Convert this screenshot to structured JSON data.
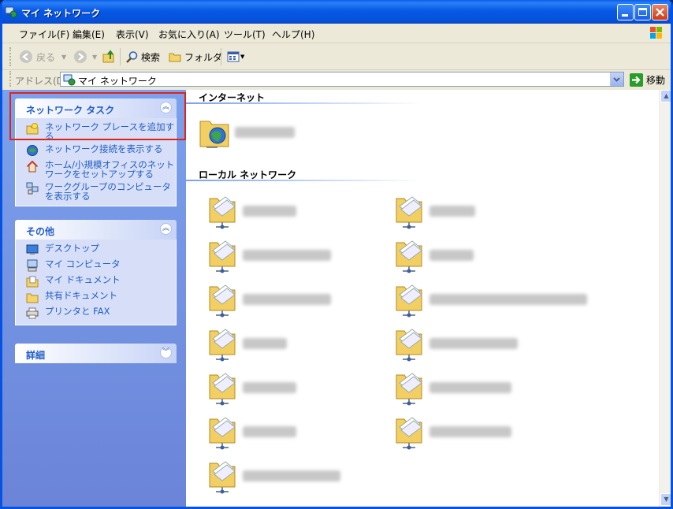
{
  "window": {
    "title": "マイ ネットワーク"
  },
  "menu": [
    "ファイル(F)",
    "編集(E)",
    "表示(V)",
    "お気に入り(A)",
    "ツール(T)",
    "ヘルプ(H)"
  ],
  "toolbar": {
    "back": "戻る",
    "search": "検索",
    "folders": "フォルダ"
  },
  "address": {
    "label": "アドレス(D)",
    "value": "マイ ネットワーク",
    "go": "移動"
  },
  "network_tasks": {
    "title": "ネットワーク タスク",
    "items": [
      "ネットワーク プレースを追加する",
      "ネットワーク接続を表示する",
      "ホーム/小規模オフィスのネットワークをセットアップする",
      "ワークグループのコンピュータを表示する"
    ]
  },
  "other_places": {
    "title": "その他",
    "items": [
      "デスクトップ",
      "マイ コンピュータ",
      "マイ ドキュメント",
      "共有ドキュメント",
      "プリンタと FAX"
    ]
  },
  "details": {
    "title": "詳細"
  },
  "groups": {
    "internet": "インターネット",
    "local": "ローカル ネットワーク"
  },
  "icons": {
    "folder": "network-folder-icon",
    "globe": "globe-icon"
  },
  "colors": {
    "title_bar": "#0559e0",
    "task_link": "#215dc6",
    "highlight": "#e2231a"
  }
}
